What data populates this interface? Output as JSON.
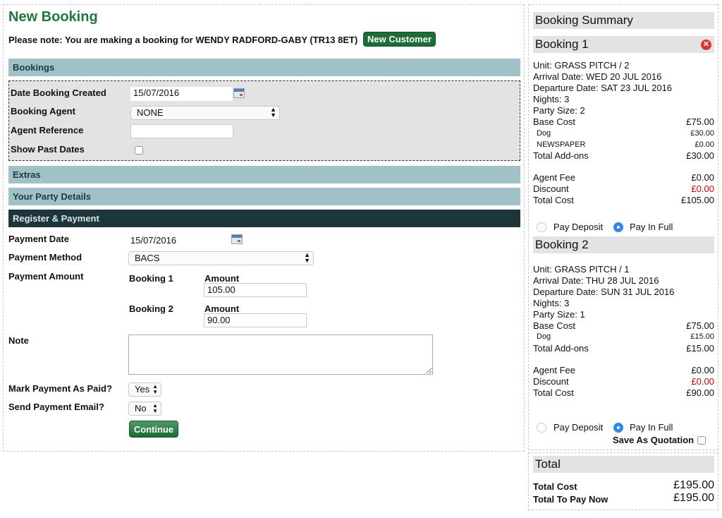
{
  "page": {
    "title": "New Booking",
    "note": "Please note: You are making a booking for WENDY RADFORD-GABY (TR13 8ET)",
    "new_customer_label": "New Customer"
  },
  "sections": {
    "bookings": "Bookings",
    "extras": "Extras",
    "party": "Your Party Details",
    "payment": "Register & Payment"
  },
  "bookings_form": {
    "date_created_label": "Date Booking Created",
    "date_created_value": "15/07/2016",
    "agent_label": "Booking Agent",
    "agent_value": "NONE",
    "reference_label": "Agent Reference",
    "reference_value": "",
    "past_dates_label": "Show Past Dates"
  },
  "payment_form": {
    "date_label": "Payment Date",
    "date_value": "15/07/2016",
    "method_label": "Payment Method",
    "method_value": "BACS",
    "amount_label": "Payment Amount",
    "rows": [
      {
        "booking": "Booking 1",
        "amount_label": "Amount",
        "amount": "105.00"
      },
      {
        "booking": "Booking 2",
        "amount_label": "Amount",
        "amount": "90.00"
      }
    ],
    "note_label": "Note",
    "mark_paid_label": "Mark Payment As Paid?",
    "mark_paid_value": "Yes",
    "send_email_label": "Send Payment Email?",
    "send_email_value": "No",
    "continue_label": "Continue"
  },
  "summary": {
    "title": "Booking Summary",
    "bookings": [
      {
        "title": "Booking 1",
        "unit": "Unit: GRASS PITCH / 2",
        "arrival": "Arrival Date: WED 20 JUL 2016",
        "departure": "Departure Date: SAT 23 JUL 2016",
        "nights": "Nights: 3",
        "party": "Party Size: 2",
        "base_label": "Base Cost",
        "base": "£75.00",
        "addons": [
          {
            "name": "Dog",
            "price": "£30.00"
          },
          {
            "name": "NEWSPAPER",
            "price": "£0.00"
          }
        ],
        "addons_label": "Total Add-ons",
        "addons_total": "£30.00",
        "agent_fee_label": "Agent Fee",
        "agent_fee": "£0.00",
        "discount_label": "Discount",
        "discount": "£0.00",
        "total_label": "Total Cost",
        "total": "£105.00",
        "deposit_label": "Pay Deposit",
        "full_label": "Pay In Full"
      },
      {
        "title": "Booking 2",
        "unit": "Unit: GRASS PITCH / 1",
        "arrival": "Arrival Date: THU 28 JUL 2016",
        "departure": "Departure Date: SUN 31 JUL 2016",
        "nights": "Nights: 3",
        "party": "Party Size: 1",
        "base_label": "Base Cost",
        "base": "£75.00",
        "addons": [
          {
            "name": "Dog",
            "price": "£15.00"
          }
        ],
        "addons_label": "Total Add-ons",
        "addons_total": "£15.00",
        "agent_fee_label": "Agent Fee",
        "agent_fee": "£0.00",
        "discount_label": "Discount",
        "discount": "£0.00",
        "total_label": "Total Cost",
        "total": "£90.00",
        "deposit_label": "Pay Deposit",
        "full_label": "Pay In Full"
      }
    ],
    "quotation_label": "Save As Quotation",
    "total_header": "Total",
    "total_cost_label": "Total Cost",
    "total_cost": "£195.00",
    "pay_now_label": "Total To Pay Now",
    "pay_now": "£195.00"
  }
}
